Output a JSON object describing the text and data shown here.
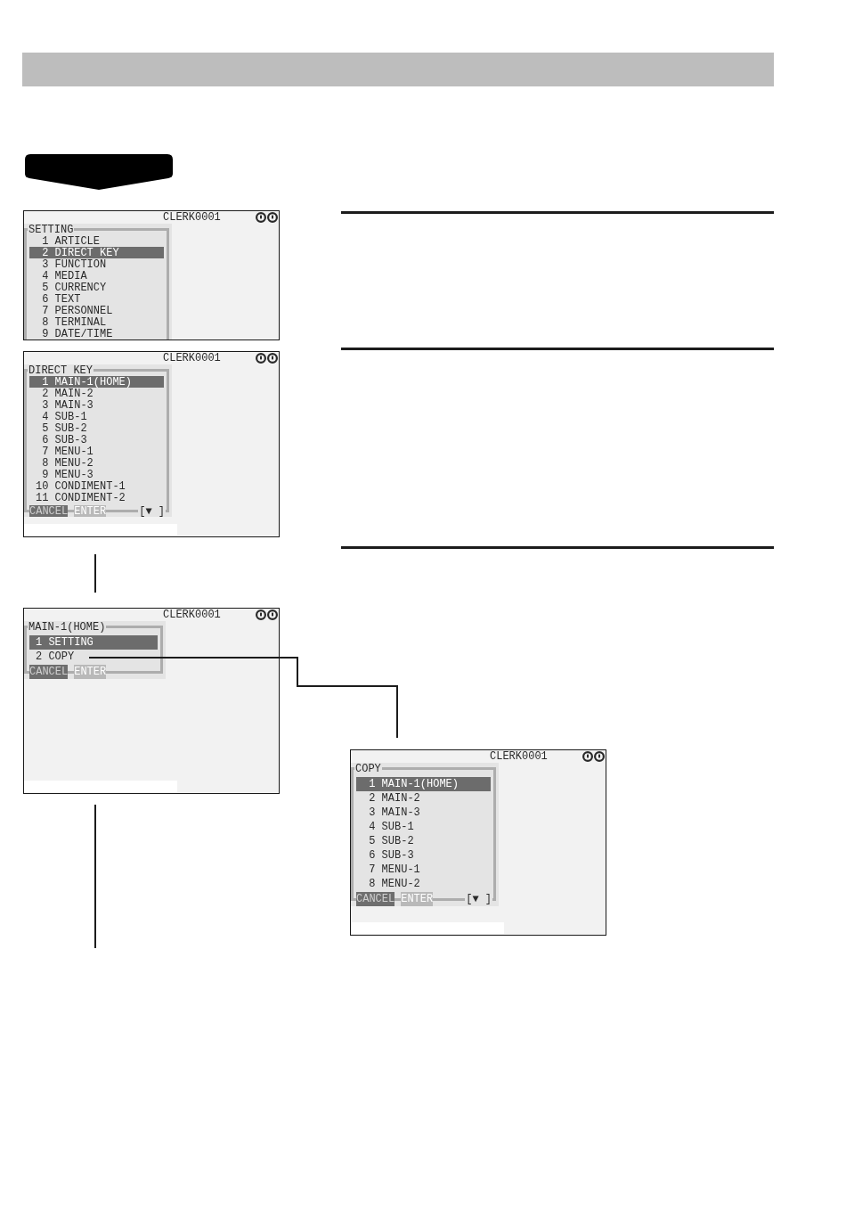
{
  "left_column": {
    "screens": [
      {
        "clerk": "CLERK0001",
        "title": "SETTING",
        "items": [
          {
            "number": "1",
            "label": "ARTICLE",
            "selected": false
          },
          {
            "number": "2",
            "label": "DIRECT KEY",
            "selected": true
          },
          {
            "number": "3",
            "label": "FUNCTION",
            "selected": false
          },
          {
            "number": "4",
            "label": "MEDIA",
            "selected": false
          },
          {
            "number": "5",
            "label": "CURRENCY",
            "selected": false
          },
          {
            "number": "6",
            "label": "TEXT",
            "selected": false
          },
          {
            "number": "7",
            "label": "PERSONNEL",
            "selected": false
          },
          {
            "number": "8",
            "label": "TERMINAL",
            "selected": false
          },
          {
            "number": "9",
            "label": "DATE/TIME",
            "selected": false
          }
        ]
      },
      {
        "clerk": "CLERK0001",
        "title": "DIRECT KEY",
        "items": [
          {
            "number": "1",
            "label": "MAIN-1(HOME)",
            "selected": true
          },
          {
            "number": "2",
            "label": "MAIN-2",
            "selected": false
          },
          {
            "number": "3",
            "label": "MAIN-3",
            "selected": false
          },
          {
            "number": "4",
            "label": "SUB-1",
            "selected": false
          },
          {
            "number": "5",
            "label": "SUB-2",
            "selected": false
          },
          {
            "number": "6",
            "label": "SUB-3",
            "selected": false
          },
          {
            "number": "7",
            "label": "MENU-1",
            "selected": false
          },
          {
            "number": "8",
            "label": "MENU-2",
            "selected": false
          },
          {
            "number": "9",
            "label": "MENU-3",
            "selected": false
          },
          {
            "number": "10",
            "label": "CONDIMENT-1",
            "selected": false
          },
          {
            "number": "11",
            "label": "CONDIMENT-2",
            "selected": false
          }
        ],
        "footer": {
          "cancel_button": "CANCEL",
          "enter_button": "ENTER",
          "scroll_indicator": "[▼ ]"
        }
      },
      {
        "clerk": "CLERK0001",
        "title": "MAIN-1(HOME)",
        "items": [
          {
            "number": "1",
            "label": "SETTING",
            "selected": true
          },
          {
            "number": "2",
            "label": "COPY",
            "selected": false
          }
        ],
        "footer": {
          "cancel_button": "CANCEL",
          "enter_button": "ENTER"
        }
      }
    ]
  },
  "right_column": {
    "screen": {
      "clerk": "CLERK0001",
      "title": "COPY",
      "items": [
        {
          "number": "1",
          "label": "MAIN-1(HOME)",
          "selected": true
        },
        {
          "number": "2",
          "label": "MAIN-2",
          "selected": false
        },
        {
          "number": "3",
          "label": "MAIN-3",
          "selected": false
        },
        {
          "number": "4",
          "label": "SUB-1",
          "selected": false
        },
        {
          "number": "5",
          "label": "SUB-2",
          "selected": false
        },
        {
          "number": "6",
          "label": "SUB-3",
          "selected": false
        },
        {
          "number": "7",
          "label": "MENU-1",
          "selected": false
        },
        {
          "number": "8",
          "label": "MENU-2",
          "selected": false
        }
      ],
      "footer": {
        "cancel_button": "CANCEL",
        "enter_button": "ENTER",
        "scroll_indicator": "[▼ ]"
      }
    }
  }
}
